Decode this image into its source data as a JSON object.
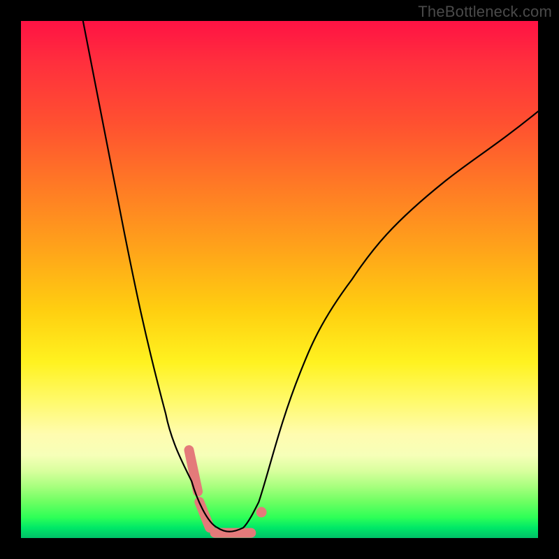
{
  "watermark": "TheBottleneck.com",
  "chart_data": {
    "type": "line",
    "title": "",
    "xlabel": "",
    "ylabel": "",
    "xlim": [
      0,
      100
    ],
    "ylim": [
      0,
      100
    ],
    "grid": false,
    "legend": false,
    "annotations": [],
    "description": "V-shaped bottleneck curve over rainbow gradient; curve descends from top-left to a flat minimum near x≈35–45 at y≈0, then rises to upper-right. Pink pill-shaped markers highlight the region near the minimum on both branches.",
    "series": [
      {
        "name": "bottleneck-curve",
        "x": [
          12,
          16,
          20,
          24,
          28,
          31,
          33,
          35,
          37,
          40,
          43,
          45,
          47,
          50,
          54,
          58,
          64,
          72,
          82,
          94,
          100
        ],
        "values": [
          100,
          85,
          69,
          53,
          37,
          24,
          15,
          8,
          3,
          1,
          1,
          3,
          7,
          13,
          22,
          32,
          44,
          57,
          69,
          80,
          85
        ]
      }
    ],
    "markers": [
      {
        "type": "segment",
        "x0": 32.5,
        "y0": 17,
        "x1": 34.2,
        "y1": 9
      },
      {
        "type": "segment",
        "x0": 34.5,
        "y0": 7,
        "x1": 36.5,
        "y1": 2
      },
      {
        "type": "segment",
        "x0": 37.5,
        "y0": 1,
        "x1": 44.5,
        "y1": 1
      },
      {
        "type": "dot",
        "x": 46.5,
        "y": 5
      }
    ]
  }
}
